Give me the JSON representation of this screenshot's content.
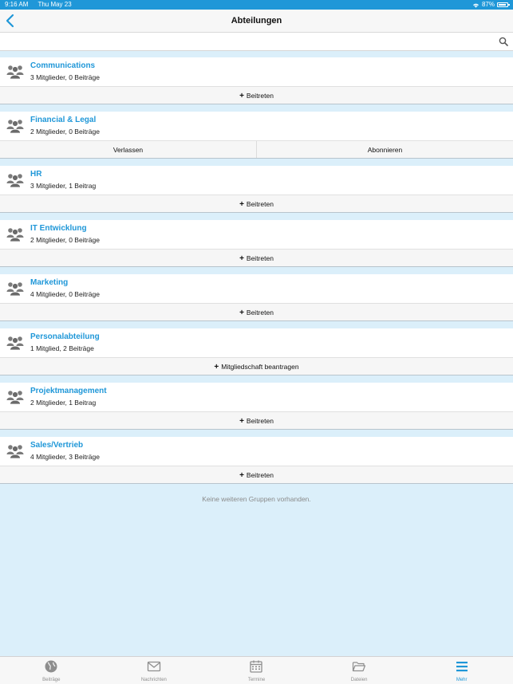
{
  "status": {
    "time": "9:16 AM",
    "date": "Thu May 23",
    "battery": "87%"
  },
  "nav": {
    "title": "Abteilungen"
  },
  "search": {
    "placeholder": "",
    "value": ""
  },
  "groups": [
    {
      "name": "Communications",
      "meta": "3 Mitglieder, 0 Beiträge",
      "actions": [
        "Beitreten"
      ],
      "plus": true
    },
    {
      "name": "Financial & Legal",
      "meta": "2 Mitglieder, 0 Beiträge",
      "actions": [
        "Verlassen",
        "Abonnieren"
      ],
      "plus": false
    },
    {
      "name": "HR",
      "meta": "3 Mitglieder, 1 Beitrag",
      "actions": [
        "Beitreten"
      ],
      "plus": true
    },
    {
      "name": "IT Entwicklung",
      "meta": "2 Mitglieder, 0 Beiträge",
      "actions": [
        "Beitreten"
      ],
      "plus": true
    },
    {
      "name": "Marketing",
      "meta": "4 Mitglieder, 0 Beiträge",
      "actions": [
        "Beitreten"
      ],
      "plus": true
    },
    {
      "name": "Personalabteilung",
      "meta": "1 Mitglied, 2 Beiträge",
      "actions": [
        "Mitgliedschaft beantragen"
      ],
      "plus": true
    },
    {
      "name": "Projektmanagement",
      "meta": "2 Mitglieder, 1 Beitrag",
      "actions": [
        "Beitreten"
      ],
      "plus": true
    },
    {
      "name": "Sales/Vertrieb",
      "meta": "4 Mitglieder, 3 Beiträge",
      "actions": [
        "Beitreten"
      ],
      "plus": true
    }
  ],
  "footer_note": "Keine weiteren Gruppen vorhanden.",
  "tabs": [
    {
      "label": "Beiträge",
      "icon": "globe-icon",
      "active": false
    },
    {
      "label": "Nachrichten",
      "icon": "envelope-icon",
      "active": false
    },
    {
      "label": "Termine",
      "icon": "calendar-icon",
      "active": false
    },
    {
      "label": "Dateien",
      "icon": "folder-icon",
      "active": false
    },
    {
      "label": "Mehr",
      "icon": "menu-icon",
      "active": true
    }
  ],
  "colors": {
    "accent": "#1f97d8",
    "background": "#dbeffa"
  }
}
